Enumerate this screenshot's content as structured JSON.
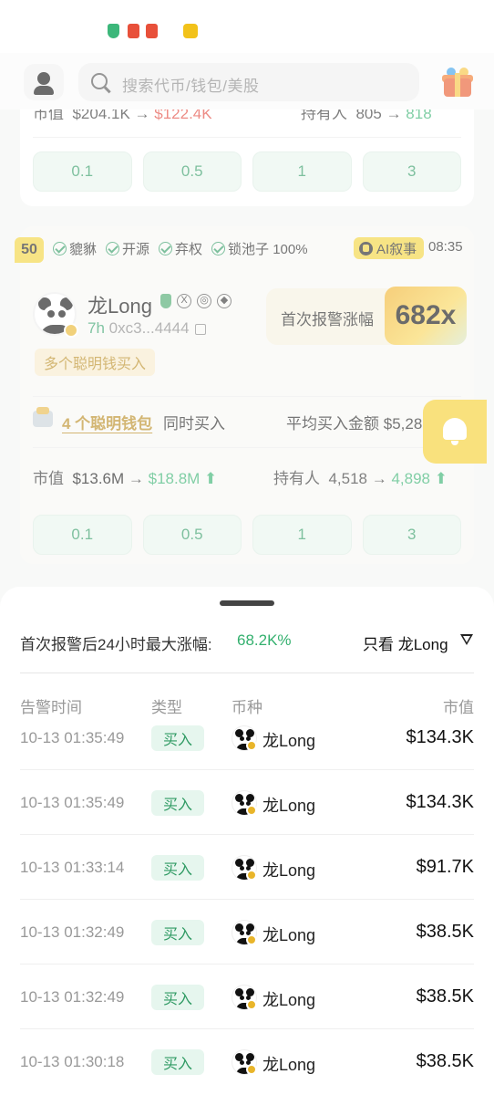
{
  "search": {
    "placeholder": "搜索代币/钱包/美股"
  },
  "card1": {
    "mcap_label": "市值",
    "mcap_from": "$204.1K",
    "mcap_arrow": "→",
    "mcap_to": "$122.4K",
    "holders_label": "持有人",
    "holders_from": "805",
    "holders_arrow": "→",
    "holders_to": "818",
    "amounts": [
      "0.1",
      "0.5",
      "1",
      "3"
    ]
  },
  "card2": {
    "rank": "50",
    "flags": [
      "貔貅",
      "开源",
      "弃权",
      "锁池子 100%"
    ],
    "ai_badge": "AI叙事",
    "time": "08:35",
    "token_name": "龙Long",
    "age": "7h",
    "address": "0xc3...4444",
    "smart_tag": "多个聪明钱买入",
    "first_alert_label": "首次报警涨幅",
    "multiplier": "682x",
    "wallet_count": "4 个聪明钱包",
    "wallet_text": "同时买入",
    "avg_label": "平均买入金额",
    "avg_value": "$5,28",
    "mcap_label": "市值",
    "mcap_from": "$13.6M",
    "mcap_arrow": "→",
    "mcap_to": "$18.8M",
    "holders_label": "持有人",
    "holders_from": "4,518",
    "holders_arrow": "→",
    "holders_to": "4,898",
    "amounts": [
      "0.1",
      "0.5",
      "1",
      "3"
    ]
  },
  "sheet": {
    "title": "首次报警后24小时最大涨幅:",
    "max_gain": "68.2K%",
    "filter_label": "只看 龙Long",
    "columns": {
      "time": "告警时间",
      "type": "类型",
      "coin": "币种",
      "mcap": "市值"
    },
    "rows": [
      {
        "time": "10-13 01:35:49",
        "type": "买入",
        "coin": "龙Long",
        "mcap": "$134.3K"
      },
      {
        "time": "10-13 01:35:49",
        "type": "买入",
        "coin": "龙Long",
        "mcap": "$134.3K"
      },
      {
        "time": "10-13 01:33:14",
        "type": "买入",
        "coin": "龙Long",
        "mcap": "$91.7K"
      },
      {
        "time": "10-13 01:32:49",
        "type": "买入",
        "coin": "龙Long",
        "mcap": "$38.5K"
      },
      {
        "time": "10-13 01:32:49",
        "type": "买入",
        "coin": "龙Long",
        "mcap": "$38.5K"
      },
      {
        "time": "10-13 01:30:18",
        "type": "买入",
        "coin": "龙Long",
        "mcap": "$38.5K"
      }
    ]
  },
  "colors": {
    "accent_green": "#33b06e",
    "accent_yellow": "#f3d33a",
    "down_red": "#e2453a"
  },
  "icons": [
    "shield-icon",
    "user-icon",
    "search-icon",
    "gift-icon",
    "check-icon",
    "ai-icon",
    "x-icon",
    "globe-icon",
    "copy-icon",
    "wallet-icon",
    "bell-icon",
    "filter-icon"
  ]
}
